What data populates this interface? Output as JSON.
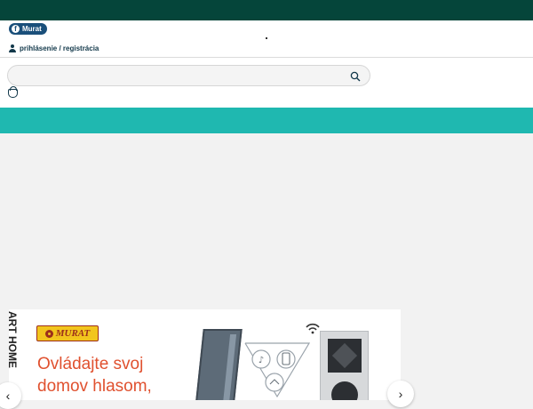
{
  "topbar": {},
  "header": {
    "facebook_label": "Murat",
    "login_text": "prihlásenie / registrácia",
    "search": {
      "placeholder": ""
    }
  },
  "banner": {
    "vertical_text": "ART HOME",
    "logo_text": "MURAT",
    "headline_line1": "Ovládajte svoj",
    "headline_line2": "domov hlasom,",
    "prev_arrow": "‹",
    "next_arrow": "›"
  },
  "colors": {
    "topbar": "#05453a",
    "teal_band": "#1fb8b0",
    "accent_headline": "#e0512f",
    "logo_yellow": "#f2c51d",
    "logo_red": "#9c2f1b"
  },
  "icons": [
    "facebook-icon",
    "user-icon",
    "search-icon",
    "cart-icon",
    "wifi-icon",
    "chevron-left-icon",
    "chevron-right-icon"
  ]
}
